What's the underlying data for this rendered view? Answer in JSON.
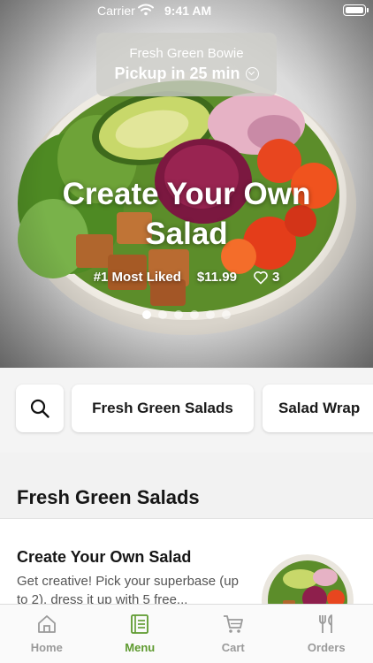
{
  "status_bar": {
    "carrier": "Carrier",
    "time": "9:41 AM"
  },
  "location": {
    "name": "Fresh Green Bowie",
    "pickup": "Pickup in 25 min"
  },
  "hero": {
    "title": "Create Your Own Salad",
    "badge": "#1 Most Liked",
    "price": "$11.99",
    "likes": "3",
    "slides": 6,
    "active_slide": 1
  },
  "categories": {
    "search_icon": "search-icon",
    "items": [
      "Fresh Green Salads",
      "Salad Wrap"
    ]
  },
  "section": {
    "title": "Fresh Green Salads",
    "items": [
      {
        "name": "Create Your Own Salad",
        "description": "Get creative! Pick your superbase (up to 2), dress it up with 5 free..."
      }
    ]
  },
  "tab_bar": {
    "tabs": [
      {
        "label": "Home",
        "icon": "home-icon"
      },
      {
        "label": "Menu",
        "icon": "menu-icon"
      },
      {
        "label": "Cart",
        "icon": "cart-icon"
      },
      {
        "label": "Orders",
        "icon": "fork-knife-icon"
      }
    ],
    "active": "Menu"
  },
  "colors": {
    "accent": "#5e9a2f",
    "inactive": "#9a9a9a",
    "background": "#f2f2f2"
  }
}
